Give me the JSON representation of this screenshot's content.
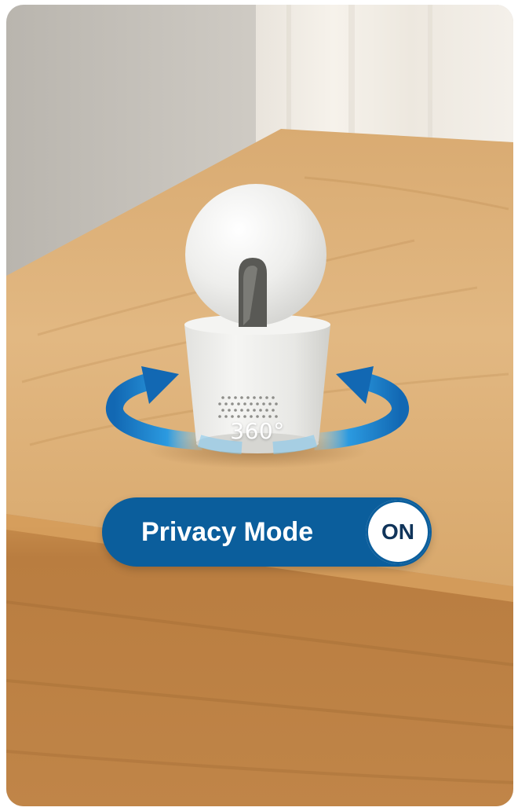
{
  "image": {
    "subject": "pan-tilt indoor camera on wooden table",
    "rotation_label": "360°",
    "overlay": {
      "label": "Privacy Mode",
      "state": "ON",
      "toggle_on": true
    }
  },
  "colors": {
    "pill_blue": "#0b5e9c",
    "arrow_blue": "#1e8fd6",
    "camera_white": "#ececea",
    "wood": "#d6a466",
    "wall": "#c9c4bb",
    "curtain": "#f3efe8"
  },
  "icons": {
    "left_arrow": "rotate-left-arrow-icon",
    "right_arrow": "rotate-right-arrow-icon"
  }
}
